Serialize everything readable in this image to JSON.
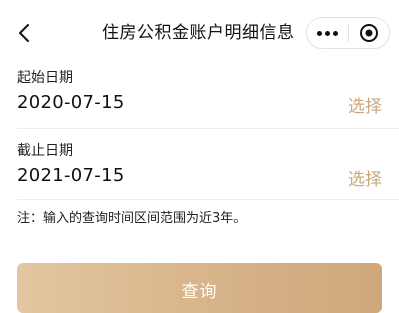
{
  "header": {
    "title": "住房公积金账户明细信息",
    "back_icon": "chevron-left-icon",
    "more_icon": "more-dots-icon",
    "close_icon": "target-circle-icon"
  },
  "form": {
    "start": {
      "label": "起始日期",
      "value": "2020-07-15",
      "action": "选择"
    },
    "end": {
      "label": "截止日期",
      "value": "2021-07-15",
      "action": "选择"
    },
    "note": "注：输入的查询时间区间范围为近3年。"
  },
  "submit_label": "查询",
  "colors": {
    "accent": "#c9a97b",
    "button_gradient_start": "#e3c6a2",
    "button_gradient_end": "#cfa77a"
  }
}
